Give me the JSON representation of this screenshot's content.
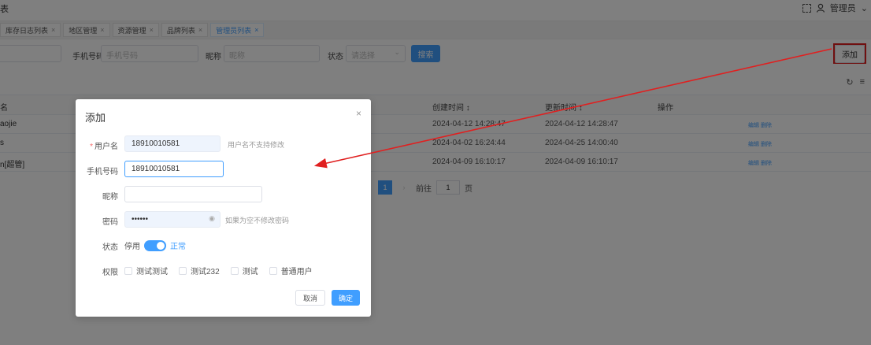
{
  "topbar": {
    "title": "表",
    "user_label": "管理员"
  },
  "tabs": [
    {
      "label": "库存日志列表",
      "close": "×"
    },
    {
      "label": "地区管理",
      "close": "×"
    },
    {
      "label": "资源管理",
      "close": "×"
    },
    {
      "label": "品牌列表",
      "close": "×"
    },
    {
      "label": "管理员列表",
      "close": "×"
    }
  ],
  "filters": {
    "phone_label": "手机号码",
    "phone_placeholder": "手机号码",
    "nick_label": "昵称",
    "nick_placeholder": "昵称",
    "status_label": "状态",
    "status_placeholder": "请选择",
    "search_label": "搜索",
    "add_label": "添加"
  },
  "table": {
    "headers": {
      "name": "名",
      "created": "创建时间 ↕",
      "updated": "更新时间 ↕",
      "ops": "操作"
    },
    "rows": [
      {
        "name": "aojie",
        "created": "2024-04-12 14:28:47",
        "updated": "2024-04-12 14:28:47",
        "ops": "编辑 删除"
      },
      {
        "name": "s",
        "created": "2024-04-02 16:24:44",
        "updated": "2024-04-25 14:00:40",
        "ops": "编辑 删除"
      },
      {
        "name": "n[超管]",
        "created": "2024-04-09 16:10:17",
        "updated": "2024-04-09 16:10:17",
        "ops": "编辑 删除"
      }
    ]
  },
  "pager": {
    "current": "1",
    "goto_label": "前往",
    "goto_value": "1",
    "page_unit": "页"
  },
  "dialog": {
    "title": "添加",
    "username_label": "用户名",
    "username_value": "18910010581",
    "username_hint": "用户名不支持修改",
    "phone_label": "手机号码",
    "phone_value": "18910010581",
    "nick_label": "昵称",
    "nick_value": "",
    "password_label": "密码",
    "password_value": "••••••",
    "password_hint": "如果为空不修改密码",
    "status_label": "状态",
    "status_off": "停用",
    "status_on": "正常",
    "perm_label": "权限",
    "perms": [
      "测试测试",
      "测试232",
      "测试",
      "普通用户"
    ],
    "cancel_label": "取消",
    "ok_label": "确定"
  },
  "colors": {
    "primary": "#409eff",
    "annotation": "#e02020"
  }
}
